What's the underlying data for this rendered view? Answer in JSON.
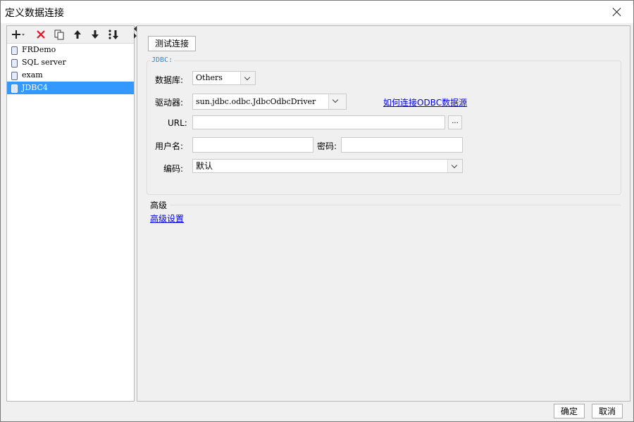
{
  "window": {
    "title": "定义数据连接"
  },
  "toolbar": {
    "add": "+",
    "delete": "✕",
    "copy": "copy",
    "up": "↑",
    "down": "↓",
    "sort": "sort"
  },
  "connections": [
    {
      "label": "FRDemo"
    },
    {
      "label": "SQL server"
    },
    {
      "label": "exam"
    },
    {
      "label": "JDBC4",
      "selected": true
    }
  ],
  "main": {
    "test_button": "测试连接",
    "group_title": "JDBC:",
    "database_label": "数据库:",
    "database_value": "Others",
    "driver_label": "驱动器:",
    "driver_value": "sun.jdbc.odbc.JdbcOdbcDriver",
    "help_link": "如何连接ODBC数据源",
    "url_label": "URL:",
    "url_value": "",
    "url_browse": "...",
    "user_label": "用户名:",
    "user_value": "",
    "password_label": "密码:",
    "password_value": "",
    "encoding_label": "编码:",
    "encoding_value": "默认",
    "advanced_title": "高级",
    "advanced_link": "高级设置"
  },
  "footer": {
    "ok": "确定",
    "cancel": "取消"
  },
  "colors": {
    "selection": "#3399ff",
    "group_title": "#3a88c9",
    "link": "#0000ee",
    "delete_icon": "#e81123"
  }
}
